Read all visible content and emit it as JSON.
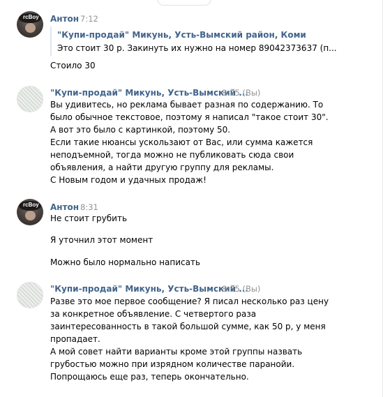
{
  "messages": [
    {
      "author": "Антон",
      "time": "7:12",
      "avatar_text": "rcBoy",
      "forward": {
        "title": "\"Купи-продай\" Микунь, Усть-Вымский район, Коми",
        "text": "Это стоит 30 р. Закинуть их нужно на номер 89042373637 (п..."
      },
      "lines": [
        "Стоило 30"
      ]
    },
    {
      "author": "\"Купи-продай\" Микунь, Усть-Вымский ...",
      "time": "8:25 (Вы)",
      "lines": [
        "Вы удивитесь, но реклама бывает разная по содержанию. То",
        "было обычное текстовое, поэтому я написал \"такое стоит 30\".",
        "А вот это было с картинкой, поэтому 50.",
        "Если такие нюансы ускользают от Вас, или сумма кажется",
        "неподъемной, тогда можно не публиковать сюда свои",
        "объявления, а найти другую группу для рекламы.",
        "С Новым годом и удачных продаж!"
      ]
    },
    {
      "author": "Антон",
      "time": "8:31",
      "avatar_text": "rcBoy",
      "lines": [
        "Не стоит грубить",
        "Я уточнил этот момент",
        "Можно было нормально написать"
      ]
    },
    {
      "author": "\"Купи-продай\" Микунь, Усть-Вымский ...",
      "time": "8:35 (Вы)",
      "lines": [
        "Разве это мое первое сообщение? Я писал несколько раз цену",
        "за конкретное объявление. С четвертого раза",
        "заинтересованность в такой большой сумме, как 50 р, у меня",
        "пропадает.",
        "А мой совет найти варианты кроме этой группы назвать",
        "грубостью можно при изрядном количестве паранойи.",
        "Попрощаюсь еще раз, теперь окончательно."
      ]
    }
  ]
}
